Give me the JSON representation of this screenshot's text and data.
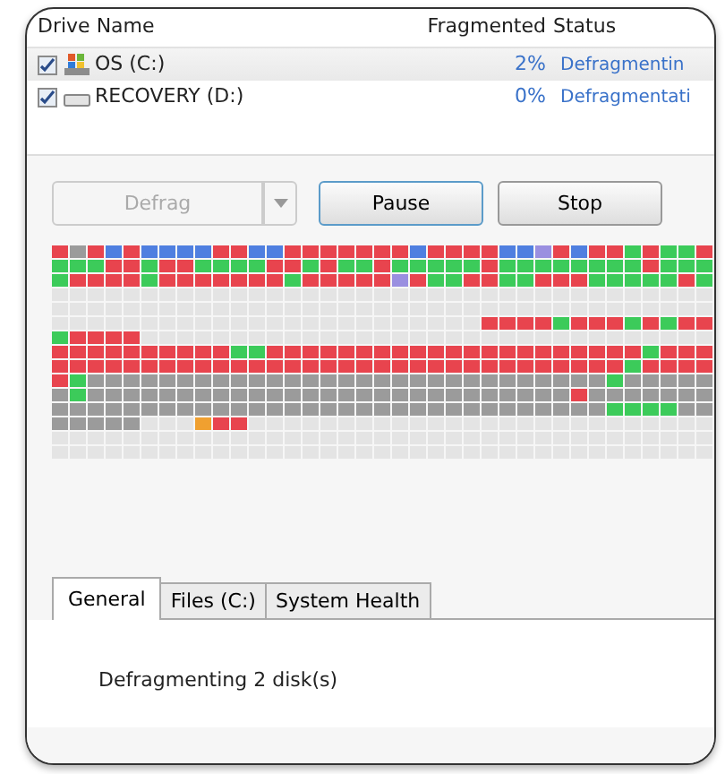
{
  "columns": [
    "Drive Name",
    "Fragmented",
    "Status"
  ],
  "drives": [
    {
      "name": "OS (C:)",
      "fragmented": "2%",
      "status": "Defragmentin",
      "checked": true,
      "selected": true,
      "kind": "system"
    },
    {
      "name": "RECOVERY (D:)",
      "fragmented": "0%",
      "status": "Defragmentati",
      "checked": true,
      "selected": false,
      "kind": "disk"
    }
  ],
  "buttons": [
    {
      "label": "Defrag",
      "disabled": true,
      "kind": "split"
    },
    {
      "label": "Pause",
      "disabled": false,
      "kind": "plain"
    },
    {
      "label": "Stop",
      "disabled": false,
      "kind": "plain"
    }
  ],
  "tabs": [
    {
      "label": "General",
      "selected": true
    },
    {
      "label": "Files (C:)",
      "selected": false
    },
    {
      "label": "System Health",
      "selected": false
    }
  ],
  "status_text": "Defragmenting 2 disk(s)"
}
